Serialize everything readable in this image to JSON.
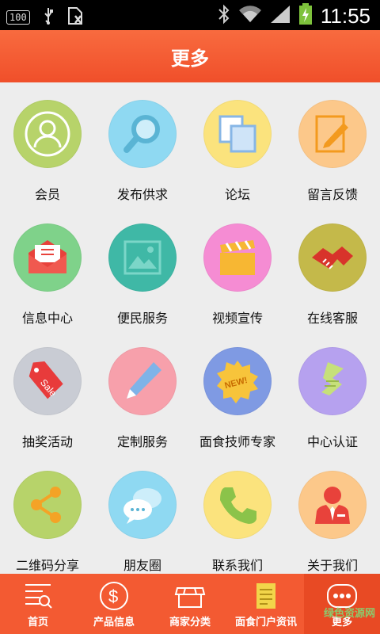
{
  "status_bar": {
    "battery_label": "100",
    "time": "11:55"
  },
  "header": {
    "title": "更多"
  },
  "grid": {
    "items": [
      {
        "label": "会员",
        "icon": "member-icon",
        "color": "#b7d36a"
      },
      {
        "label": "发布供求",
        "icon": "search-icon",
        "color": "#8fd9f2"
      },
      {
        "label": "论坛",
        "icon": "forum-icon",
        "color": "#fbe37d"
      },
      {
        "label": "留言反馈",
        "icon": "feedback-icon",
        "color": "#fcc88a"
      },
      {
        "label": "信息中心",
        "icon": "mail-icon",
        "color": "#7fd28a"
      },
      {
        "label": "便民服务",
        "icon": "picture-icon",
        "color": "#3fb8a6"
      },
      {
        "label": "视频宣传",
        "icon": "clapper-icon",
        "color": "#f58cd3"
      },
      {
        "label": "在线客服",
        "icon": "handshake-icon",
        "color": "#c4b94a"
      },
      {
        "label": "抽奖活动",
        "icon": "sale-tag-icon",
        "color": "#c9ccd4"
      },
      {
        "label": "定制服务",
        "icon": "pencil-icon",
        "color": "#f7a0ab"
      },
      {
        "label": "面食技师专家",
        "icon": "new-badge-icon",
        "color": "#7f9ae3"
      },
      {
        "label": "中心认证",
        "icon": "certificate-icon",
        "color": "#b6a1ef"
      },
      {
        "label": "二维码分享",
        "icon": "share-icon",
        "color": "#b7d36a"
      },
      {
        "label": "朋友圈",
        "icon": "chat-icon",
        "color": "#8fd9f2"
      },
      {
        "label": "联系我们",
        "icon": "phone-icon",
        "color": "#fbe37d"
      },
      {
        "label": "关于我们",
        "icon": "person-icon",
        "color": "#fcc88a"
      }
    ]
  },
  "bottom_nav": {
    "items": [
      {
        "label": "首页",
        "icon": "home-list-icon"
      },
      {
        "label": "产品信息",
        "icon": "dollar-icon"
      },
      {
        "label": "商家分类",
        "icon": "store-icon"
      },
      {
        "label": "面食门户资讯",
        "icon": "news-icon"
      },
      {
        "label": "更多",
        "icon": "more-icon"
      }
    ],
    "active_index": 4
  },
  "watermark": "绿色资源网"
}
